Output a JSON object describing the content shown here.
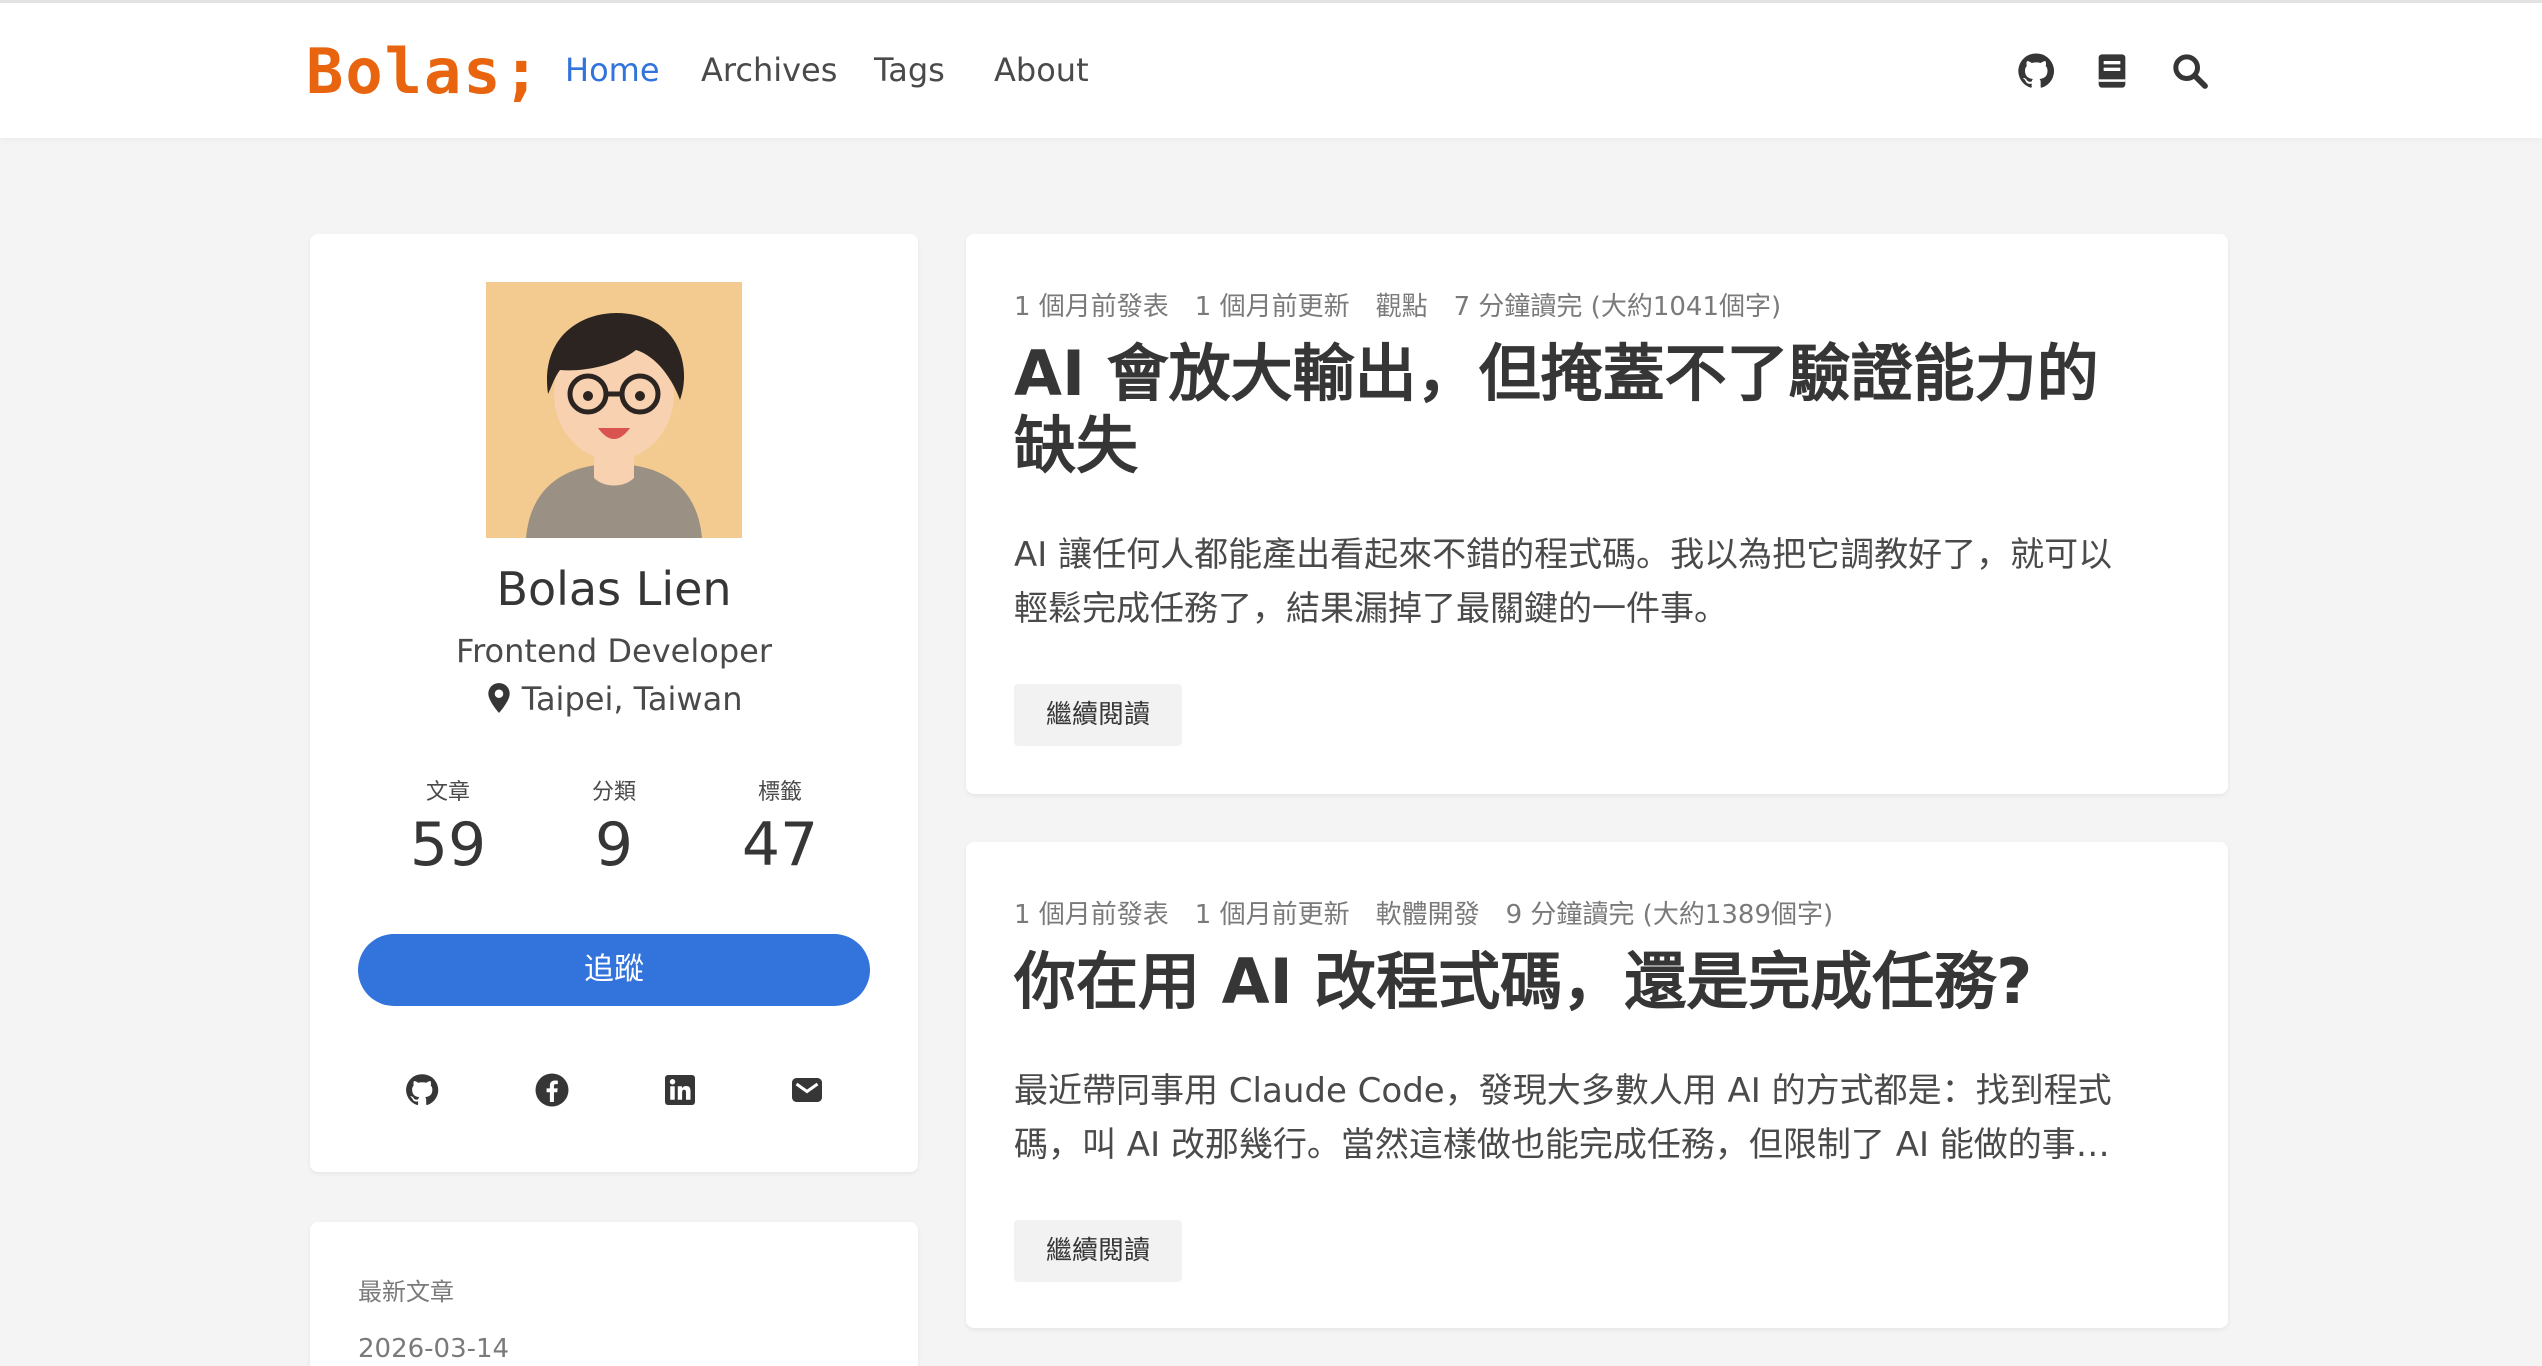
{
  "brand": {
    "logo": "Bolas;",
    "accent": "#e8640f"
  },
  "nav": {
    "items": [
      {
        "label": "Home",
        "active": true
      },
      {
        "label": "Archives",
        "active": false
      },
      {
        "label": "Tags",
        "active": false
      },
      {
        "label": "About",
        "active": false
      }
    ],
    "icons": [
      "github-icon",
      "book-icon",
      "search-icon"
    ]
  },
  "profile": {
    "name": "Bolas Lien",
    "role": "Frontend Developer",
    "location": "Taipei, Taiwan",
    "stats": [
      {
        "label": "文章",
        "value": "59"
      },
      {
        "label": "分類",
        "value": "9"
      },
      {
        "label": "標籤",
        "value": "47"
      }
    ],
    "follow_label": "追蹤",
    "socials": [
      "github-icon",
      "facebook-icon",
      "linkedin-icon",
      "email-icon"
    ]
  },
  "recent": {
    "label": "最新文章",
    "date": "2026-03-14"
  },
  "posts": [
    {
      "meta": "1 個月前發表　1 個月前更新　觀點　7 分鐘讀完 (大約1041個字)",
      "title_line1": "AI 會放大輸出，但掩蓋不了驗證能力的",
      "title_line2": "缺失",
      "excerpt_line1": "AI 讓任何人都能產出看起來不錯的程式碼。我以為把它調教好了，就可以",
      "excerpt_line2": "輕鬆完成任務了，結果漏掉了最關鍵的一件事。",
      "more_label": "繼續閱讀"
    },
    {
      "meta": "1 個月前發表　1 個月前更新　軟體開發　9 分鐘讀完 (大約1389個字)",
      "title_line1": "你在用 AI 改程式碼，還是完成任務?",
      "excerpt_line1": "最近帶同事用 Claude Code，發現大多數人用 AI 的方式都是：找到程式",
      "excerpt_line2": "碼，叫 AI 改那幾行。當然這樣做也能完成任務，但限制了 AI 能做的事…",
      "more_label": "繼續閱讀"
    }
  ],
  "colors": {
    "link": "#3273dc",
    "bg": "#f4f4f4",
    "text": "#4a4a4a",
    "heading": "#363636"
  }
}
